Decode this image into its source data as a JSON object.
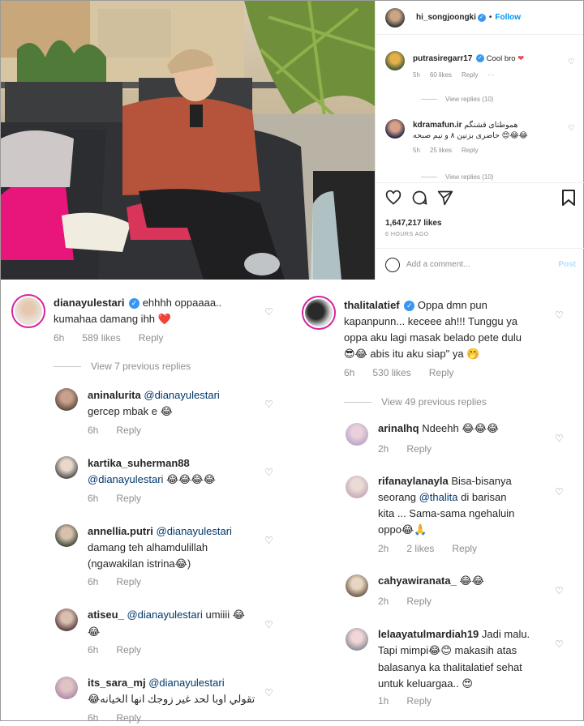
{
  "post": {
    "author": "hi_songjoongki",
    "follow_label": "Follow",
    "likes": "1,647,217 likes",
    "time_ago": "6 HOURS AGO",
    "add_comment_placeholder": "Add a comment...",
    "post_label": "Post",
    "comments": [
      {
        "user": "putrasiregarr17",
        "text": "Cool bro",
        "emoji": "❤",
        "time": "5h",
        "likes": "60 likes",
        "reply": "Reply",
        "more": "···",
        "view_replies": "View replies (10)"
      },
      {
        "user": "kdramafun.ir",
        "text": "هموطنای قشنگم",
        "text2": "حاضری بزنین ۸ و نیم صبحه",
        "emoji2": "😍😂😂",
        "time": "5h",
        "likes": "25 likes",
        "reply": "Reply",
        "view_replies": "View replies (10)"
      }
    ]
  },
  "left_thread": {
    "main": {
      "user": "dianayulestari",
      "line1": "ehhhh oppaaaa..",
      "line2": "kumahaa damang ihh",
      "emoji": "❤️",
      "time": "6h",
      "likes": "589 likes",
      "reply": "Reply"
    },
    "view_previous": "View 7 previous replies",
    "replies": [
      {
        "user": "aninalurita",
        "mention": "@dianayulestari",
        "line2": "gercep mbak e",
        "emoji": "😂",
        "time": "6h",
        "reply": "Reply"
      },
      {
        "user": "kartika_suherman88",
        "mention": "@dianayulestari",
        "emoji": "😂😂😂😂",
        "time": "6h",
        "reply": "Reply"
      },
      {
        "user": "annellia.putri",
        "mention": "@dianayulestari",
        "line2": "damang teh alhamdulillah",
        "line3": "(ngawakilan istrina",
        "emoji": "😂",
        "line3_end": ")",
        "time": "6h",
        "reply": "Reply"
      },
      {
        "user": "atiseu_",
        "mention": "@dianayulestari",
        "text_after": "umiiii",
        "emoji": "😂",
        "emoji2": "😂",
        "time": "6h",
        "reply": "Reply"
      },
      {
        "user": "its_sara_mj",
        "mention": "@dianayulestari",
        "line2": "تقولي اوبا لحد غير زوجك انها الخيانه",
        "emoji": "😂",
        "time": "6h",
        "reply": "Reply"
      }
    ]
  },
  "right_thread": {
    "main": {
      "user": "thalitalatief",
      "line1": "Oppa dmn pun",
      "line2": "kapanpunn... keceee ah!!! Tunggu ya",
      "line3": "oppa aku lagi masak belado pete dulu",
      "emoji_start": "😎😂",
      "line4": "abis itu aku siap\" ya",
      "emoji_end": "🤭",
      "time": "6h",
      "likes": "530 likes",
      "reply": "Reply"
    },
    "view_previous": "View 49 previous replies",
    "replies": [
      {
        "user": "arinalhq",
        "text": "Ndeehh",
        "emoji": "😂😂😂",
        "time": "2h",
        "reply": "Reply"
      },
      {
        "user": "rifanaylanayla",
        "line1": "Bisa-bisanya",
        "line2a": "seorang",
        "mention": "@thalita",
        "line2b": "di barisan",
        "line3": "kita ... Sama-sama ngehaluin",
        "line4": "oppo",
        "emoji": "😂🙏",
        "time": "2h",
        "likes": "2 likes",
        "reply": "Reply"
      },
      {
        "user": "cahyawiranata_",
        "emoji": "😂😂",
        "time": "2h",
        "reply": "Reply"
      },
      {
        "user": "lelaayatulmardiah19",
        "line1": "Jadi malu.",
        "line2a": "Tapi mimpi",
        "emoji_mid": "😂😊",
        "line2b": "makasih atas",
        "line3": "balasanya ka thalitalatief sehat",
        "line4": "untuk keluargaa..",
        "emoji_end": "😍",
        "time": "1h",
        "reply": "Reply"
      }
    ]
  },
  "colors": {
    "blue": "#3897f0",
    "link": "#00376b",
    "heart": "#ed4956"
  },
  "icons": [
    "verified-icon",
    "heart-icon",
    "comment-icon",
    "share-icon",
    "bookmark-icon",
    "emoji-icon"
  ]
}
